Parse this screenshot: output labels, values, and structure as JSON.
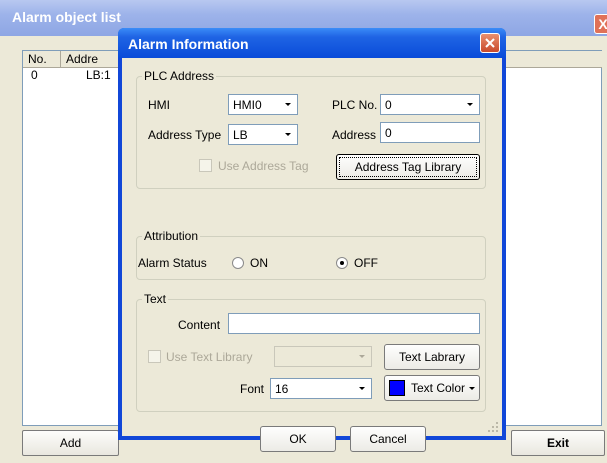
{
  "background_window": {
    "title": "Alarm object list",
    "close_label": "X",
    "columns": [
      "No.",
      "Addre"
    ],
    "rows": [
      {
        "no": "0",
        "address": "LB:1"
      }
    ],
    "buttons": {
      "add": "Add",
      "exit": "Exit"
    }
  },
  "dialog": {
    "title": "Alarm Information",
    "plc_address": {
      "legend": "PLC Address",
      "hmi_label": "HMI",
      "hmi_value": "HMI0",
      "plc_no_label": "PLC No.",
      "plc_no_value": "0",
      "address_type_label": "Address Type",
      "address_type_value": "LB",
      "address_label": "Address",
      "address_value": "0",
      "use_address_tag_label": "Use Address Tag",
      "use_address_tag_checked": false,
      "address_tag_library_button": "Address Tag Library"
    },
    "attribution": {
      "legend": "Attribution",
      "alarm_status_label": "Alarm Status",
      "on_label": "ON",
      "off_label": "OFF",
      "selected": "OFF"
    },
    "text": {
      "legend": "Text",
      "content_label": "Content",
      "content_value": "",
      "use_text_library_label": "Use Text Library",
      "use_text_library_checked": false,
      "text_library_button": "Text Labrary",
      "font_label": "Font",
      "font_value": "16",
      "text_color_button": "Text Color",
      "text_color": "#0000ff"
    },
    "ok_button": "OK",
    "cancel_button": "Cancel"
  }
}
